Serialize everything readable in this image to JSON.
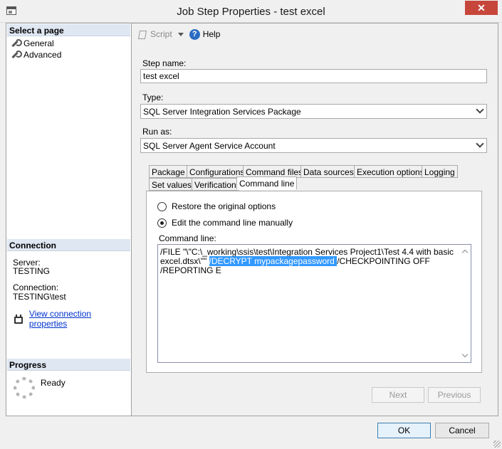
{
  "window": {
    "title": "Job Step Properties - test excel",
    "close_glyph": "✕"
  },
  "left": {
    "select_page_header": "Select a page",
    "pages": [
      "General",
      "Advanced"
    ],
    "connection_header": "Connection",
    "server_label": "Server:",
    "server_value": "TESTING",
    "connection_label": "Connection:",
    "connection_value": "TESTING\\test",
    "view_connection_link": "View connection properties",
    "progress_header": "Progress",
    "progress_status": "Ready"
  },
  "toolbar": {
    "script_label": "Script",
    "help_label": "Help",
    "help_glyph": "?"
  },
  "form": {
    "step_name_label": "Step name:",
    "step_name_value": "test excel",
    "type_label": "Type:",
    "type_value": "SQL Server Integration Services Package",
    "run_as_label": "Run as:",
    "run_as_value": "SQL Server Agent Service Account"
  },
  "tabs": {
    "row1": [
      "Package",
      "Configurations",
      "Command files",
      "Data sources",
      "Execution options",
      "Logging"
    ],
    "row2": [
      "Set values",
      "Verification",
      "Command line"
    ],
    "active": "Command line"
  },
  "command_line": {
    "restore_label": "Restore the original options",
    "edit_label": "Edit the command line manually",
    "selected_option": "edit",
    "cmd_label": "Command line:",
    "text_before": "/FILE \"\\\"C:\\_working\\ssis\\test\\Integration Services Project1\\Test 4.4 with basic excel.dtsx\\\"\" ",
    "text_highlighted": "/DECRYPT mypackagepassword ",
    "text_after": "/CHECKPOINTING OFF /REPORTING E"
  },
  "buttons": {
    "next": "Next",
    "previous": "Previous",
    "ok": "OK",
    "cancel": "Cancel"
  },
  "colors": {
    "selection": "#3399ff",
    "close_button": "#c7463b",
    "link": "#0033cc",
    "section_header": "#dfe7f2"
  }
}
